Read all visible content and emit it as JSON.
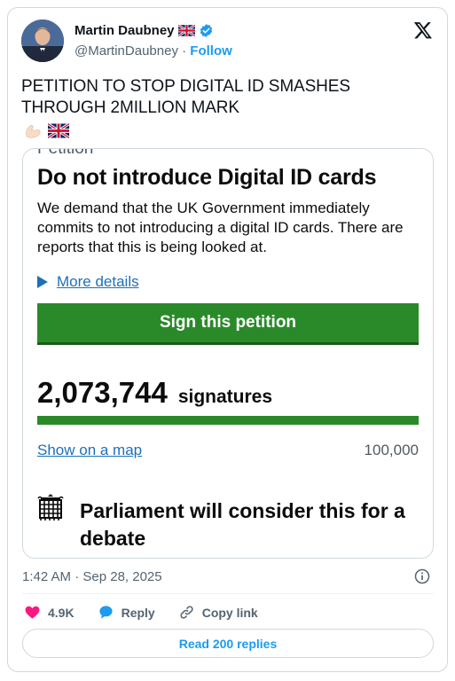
{
  "author": {
    "name": "Martin Daubney",
    "handle": "@MartinDaubney",
    "separator": " · ",
    "follow_label": "Follow",
    "flag_icon": "uk-flag-icon",
    "verified_icon": "verified-badge-icon"
  },
  "brand_icon": "x-logo-icon",
  "tweet": {
    "text": "PETITION TO STOP DIGITAL ID SMASHES THROUGH 2MILLION MARK",
    "emojis": [
      "flexed-biceps-icon",
      "uk-flag-icon"
    ]
  },
  "media": {
    "cut_label": "Petition",
    "title": "Do not introduce Digital ID cards",
    "description": "We demand that the UK Government immediately commits to not introducing a digital ID cards. There are reports that this is being looked at.",
    "more_details": "More details",
    "sign_button": "Sign this petition",
    "signature_count": "2,073,744",
    "signature_label": "signatures",
    "progress_fraction": 1.0,
    "map_link": "Show on a map",
    "threshold": "100,000",
    "parliament_text": "Parliament will consider this for a debate",
    "parliament_icon": "portcullis-icon"
  },
  "meta": {
    "timestamp": "1:42 AM · Sep 28, 2025"
  },
  "actions": {
    "likes_count": "4.9K",
    "reply_label": "Reply",
    "copy_link_label": "Copy link",
    "read_replies": "Read 200 replies"
  },
  "colors": {
    "x_blue": "#1d9bf0",
    "gov_green": "#2a8a2a",
    "gov_link": "#1d70b8",
    "like_pink": "#f91880"
  }
}
